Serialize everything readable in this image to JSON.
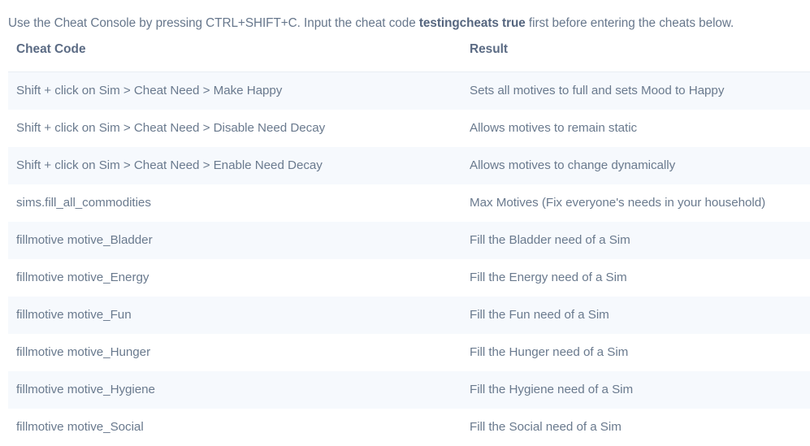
{
  "intro": {
    "part1": "Use the Cheat Console by pressing CTRL+SHIFT+C. Input the cheat code ",
    "emphasis": "testingcheats true",
    "part2": " first before entering the cheats below."
  },
  "table": {
    "headers": {
      "code": "Cheat Code",
      "result": "Result"
    },
    "rows": [
      {
        "code": "Shift + click on Sim > Cheat Need > Make Happy",
        "result": "Sets all motives to full and sets Mood to Happy"
      },
      {
        "code": "Shift + click on Sim > Cheat Need > Disable Need Decay",
        "result": "Allows motives to remain static"
      },
      {
        "code": "Shift + click on Sim > Cheat Need > Enable Need Decay",
        "result": "Allows motives to change dynamically"
      },
      {
        "code": "sims.fill_all_commodities",
        "result": "Max Motives (Fix everyone's needs in your household)"
      },
      {
        "code": "fillmotive motive_Bladder",
        "result": "Fill the Bladder need of a Sim"
      },
      {
        "code": "fillmotive motive_Energy",
        "result": "Fill the Energy need of a Sim"
      },
      {
        "code": "fillmotive motive_Fun",
        "result": "Fill the Fun need of a Sim"
      },
      {
        "code": "fillmotive motive_Hunger",
        "result": "Fill the Hunger need of a Sim"
      },
      {
        "code": "fillmotive motive_Hygiene",
        "result": "Fill the Hygiene need of a Sim"
      },
      {
        "code": "fillmotive motive_Social",
        "result": "Fill the Social need of a Sim"
      }
    ]
  },
  "colors": {
    "text": "#6a7a8e",
    "header_text": "#5b6b84",
    "stripe": "#f6f9fd",
    "background": "#ffffff",
    "rule": "#e8edf3"
  }
}
